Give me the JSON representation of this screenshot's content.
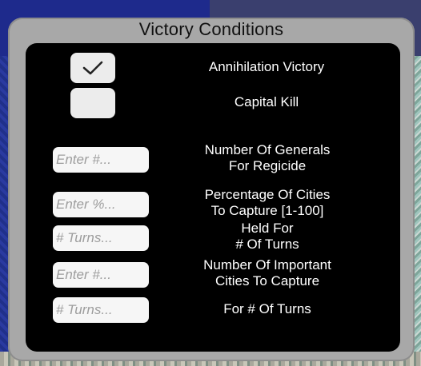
{
  "dialog": {
    "title": "Victory Conditions",
    "checkboxes": [
      {
        "label": "Annihilation Victory",
        "checked": true
      },
      {
        "label": "Capital Kill",
        "checked": false
      }
    ],
    "fields": [
      {
        "placeholder": "Enter #...",
        "label_line1": "Number Of Generals",
        "label_line2": "For Regicide"
      },
      {
        "placeholder": "Enter %...",
        "label_line1": "Percentage Of Cities",
        "label_line2": "To Capture [1-100]"
      },
      {
        "placeholder": "# Turns...",
        "label_line1": "Held For",
        "label_line2": "# Of Turns"
      },
      {
        "placeholder": "Enter #...",
        "label_line1": "Number Of Important",
        "label_line2": "Cities To Capture"
      },
      {
        "placeholder": "# Turns...",
        "label_line1": "For # Of Turns",
        "label_line2": ""
      }
    ]
  },
  "colors": {
    "dialog_bg": "#a8a8a8",
    "panel_bg": "#000000",
    "input_bg": "#f6f6f6",
    "placeholder": "#9d9d9d"
  }
}
